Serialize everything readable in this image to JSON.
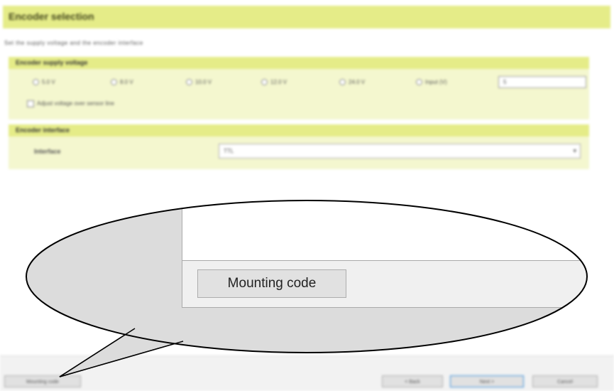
{
  "dialog": {
    "title": "Encoder selection",
    "hint": "Set the supply voltage and the encoder interface",
    "voltage_panel": {
      "title": "Encoder supply voltage",
      "options": [
        "5.0 V",
        "8.0 V",
        "10.0 V",
        "12.0 V",
        "24.0 V",
        "Input (V)"
      ],
      "custom_value": "5",
      "adjust_label": "Adjust voltage over sensor line"
    },
    "interface_panel": {
      "title": "Encoder interface",
      "label": "Interface",
      "selected": "TTL"
    }
  },
  "footer": {
    "mounting_code_small": "Mounting code",
    "back": "< Back",
    "next": "Next >",
    "cancel": "Cancel"
  },
  "zoom": {
    "mounting_code_button": "Mounting code"
  }
}
